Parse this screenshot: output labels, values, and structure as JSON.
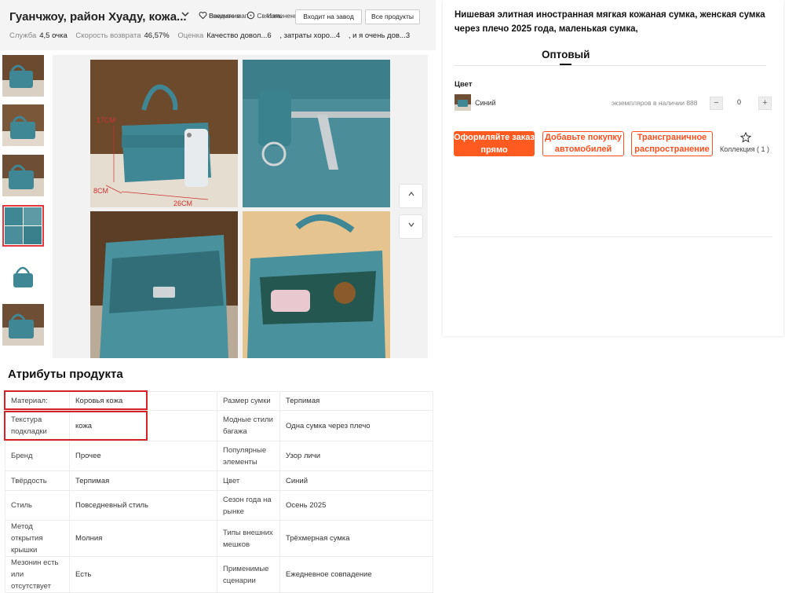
{
  "header": {
    "store_name": "Гуанчжоу, район Хуаду, кожа...",
    "actions": [
      {
        "label": "Внимание",
        "icon": "heart-icon"
      },
      {
        "label": "Введите магазин",
        "icon": "store-icon"
      },
      {
        "label": "Связаться",
        "icon": "chat-icon"
      },
      {
        "label": "Изменения в контексте",
        "icon": "share-icon"
      }
    ],
    "factory_button": "Входит на завод",
    "all_products_button": "Все продукты",
    "stats": [
      {
        "label": "Служба",
        "value": "4,5 очка"
      },
      {
        "label": "Скорость возврата",
        "value": "46,57%"
      },
      {
        "label": "Оценка",
        "value": "Качество довол...6"
      },
      {
        "label": "",
        "value": ", затраты хоро...4"
      },
      {
        "label": "",
        "value": ", и я очень дов...3"
      }
    ]
  },
  "gallery": {
    "annotations": {
      "height": "17CM",
      "depth": "8CM",
      "width": "26CM"
    },
    "prev_icon": "chevron-up-icon",
    "next_icon": "chevron-down-icon"
  },
  "product": {
    "title": "Нишевая элитная иностранная мягкая кожаная сумка, женская сумка через плечо 2025 года, маленькая сумка,",
    "tab": "Оптовый",
    "color_label": "Цвет",
    "color_name": "Синий",
    "stock_text": "экземпляров в наличии 888",
    "quantity": "0",
    "buttons": {
      "order": "Оформляйте заказ прямо",
      "cart": "Добавьте покупку автомобилей",
      "cross_border": "Трансграничное распространение"
    },
    "collection": "Коллекция ( 1 )"
  },
  "attributes": {
    "title": "Атрибуты продукта",
    "rows": [
      {
        "k1": "Материал:",
        "v1": "Коровья кожа",
        "k2": "Размер сумки",
        "v2": "Терпимая"
      },
      {
        "k1": "Текстура подкладки",
        "v1": "кожа",
        "k2": "Модные стили багажа",
        "v2": "Одна сумка через плечо"
      },
      {
        "k1": "Бренд",
        "v1": "Прочее",
        "k2": "Популярные элементы",
        "v2": "Узор личи"
      },
      {
        "k1": "Твёрдость",
        "v1": "Терпимая",
        "k2": "Цвет",
        "v2": "Синий"
      },
      {
        "k1": "Стиль",
        "v1": "Повседневный стиль",
        "k2": "Сезон года на рынке",
        "v2": "Осень 2025"
      },
      {
        "k1": "Метод открытия крышки",
        "v1": "Молния",
        "k2": "Типы внешних мешков",
        "v2": "Трёхмерная сумка"
      },
      {
        "k1": "Мезонин есть или отсутствует",
        "v1": "Есть",
        "k2": "Применимые сценарии",
        "v2": "Ежедневное совпадение"
      }
    ]
  },
  "colors": {
    "accent": "#ff5a1f",
    "highlight": "#d42226",
    "bag": "#3f8795"
  }
}
